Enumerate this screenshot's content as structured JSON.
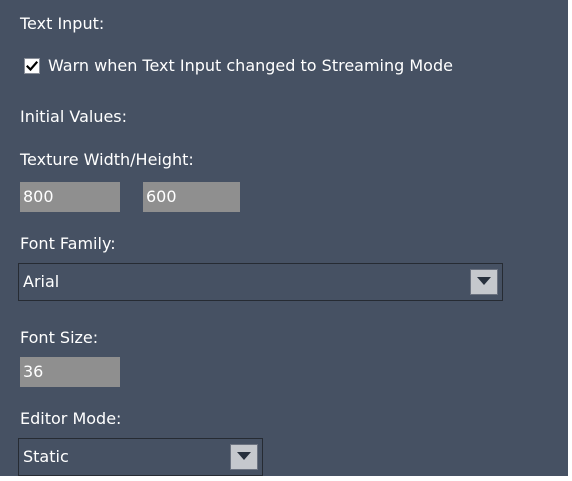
{
  "text_input": {
    "heading": "Text Input:",
    "warn_checkbox": {
      "label": "Warn when Text Input changed to Streaming Mode",
      "checked": true
    }
  },
  "initial_values": {
    "heading": "Initial Values:",
    "texture_size": {
      "label": "Texture Width/Height:",
      "width": "800",
      "height": "600"
    },
    "font_family": {
      "label": "Font Family:",
      "value": "Arial"
    },
    "font_size": {
      "label": "Font Size:",
      "value": "36"
    },
    "editor_mode": {
      "label": "Editor Mode:",
      "value": "Static"
    }
  },
  "icons": {
    "checkmark": "check-icon",
    "dropdown_arrow": "chevron-down-icon"
  }
}
